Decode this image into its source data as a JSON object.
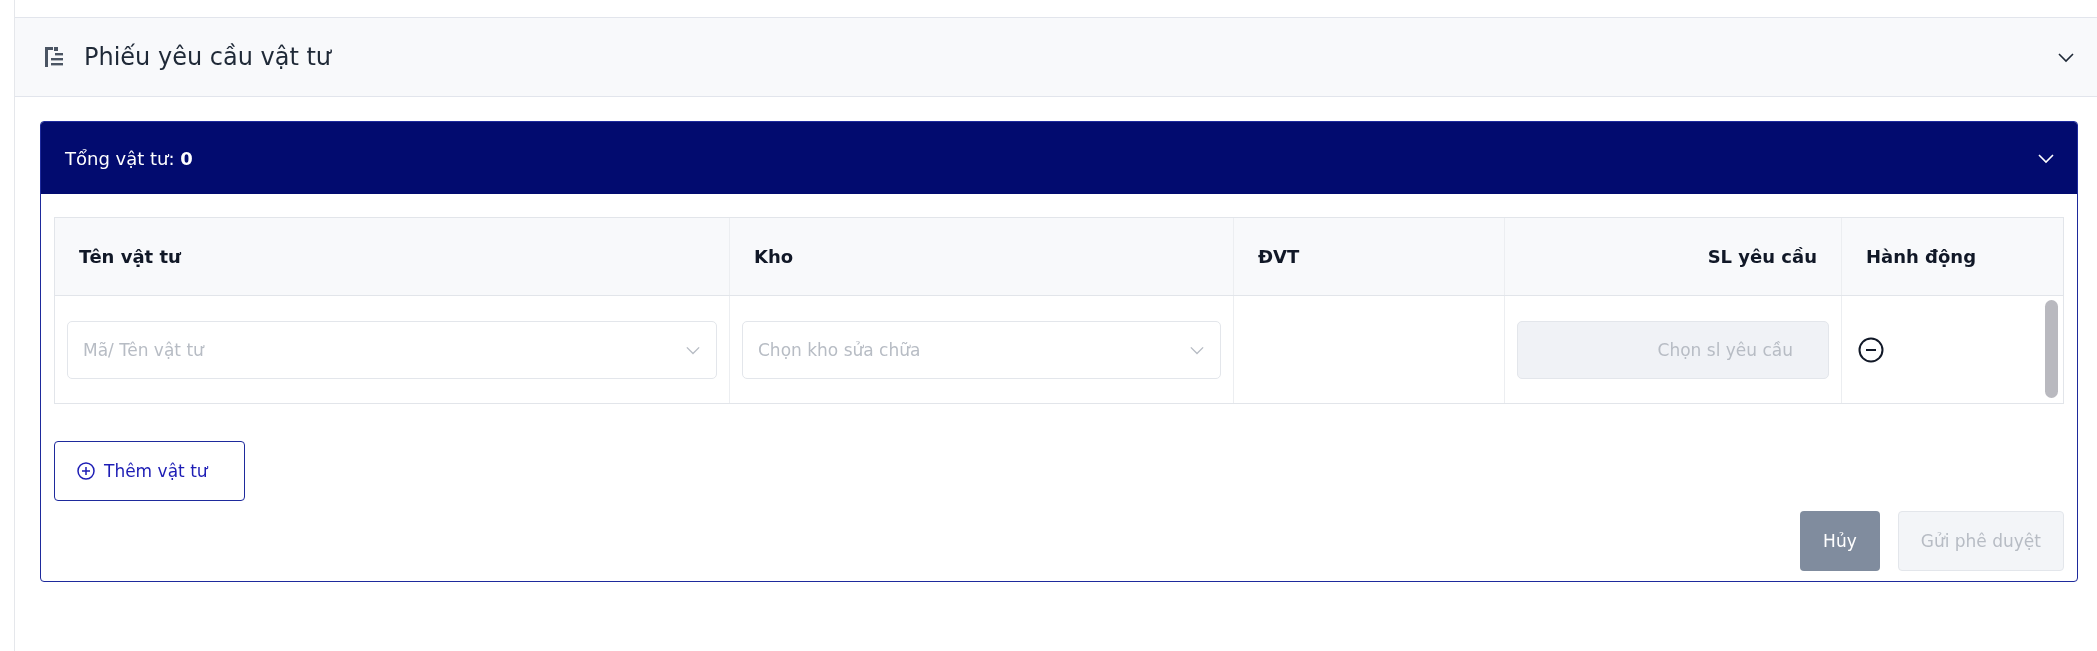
{
  "section": {
    "title": "Phiếu yêu cầu vật tư"
  },
  "panel": {
    "label": "Tổng vật tư:",
    "count": "0"
  },
  "table": {
    "columns": [
      {
        "label": "Tên vật tư",
        "kind": "text"
      },
      {
        "label": "Kho",
        "kind": "text"
      },
      {
        "label": "ĐVT",
        "kind": "text"
      },
      {
        "label": "SL yêu cầu",
        "kind": "number"
      },
      {
        "label": "Hành động",
        "kind": "text"
      }
    ],
    "rows": [
      {
        "cells": [
          {
            "kind": "select",
            "placeholder": "Mã/ Tên vật tư"
          },
          {
            "kind": "select",
            "placeholder": "Chọn kho sửa chữa"
          },
          {
            "kind": "empty"
          },
          {
            "kind": "input",
            "placeholder": "Chọn sl yêu cầu",
            "disabled": true
          },
          {
            "kind": "remove"
          }
        ]
      }
    ]
  },
  "add_button": "Thêm vật tư",
  "buttons": [
    {
      "label": "Hủy",
      "disabled": false
    },
    {
      "label": "Gửi phê duyệt",
      "disabled": true
    }
  ]
}
